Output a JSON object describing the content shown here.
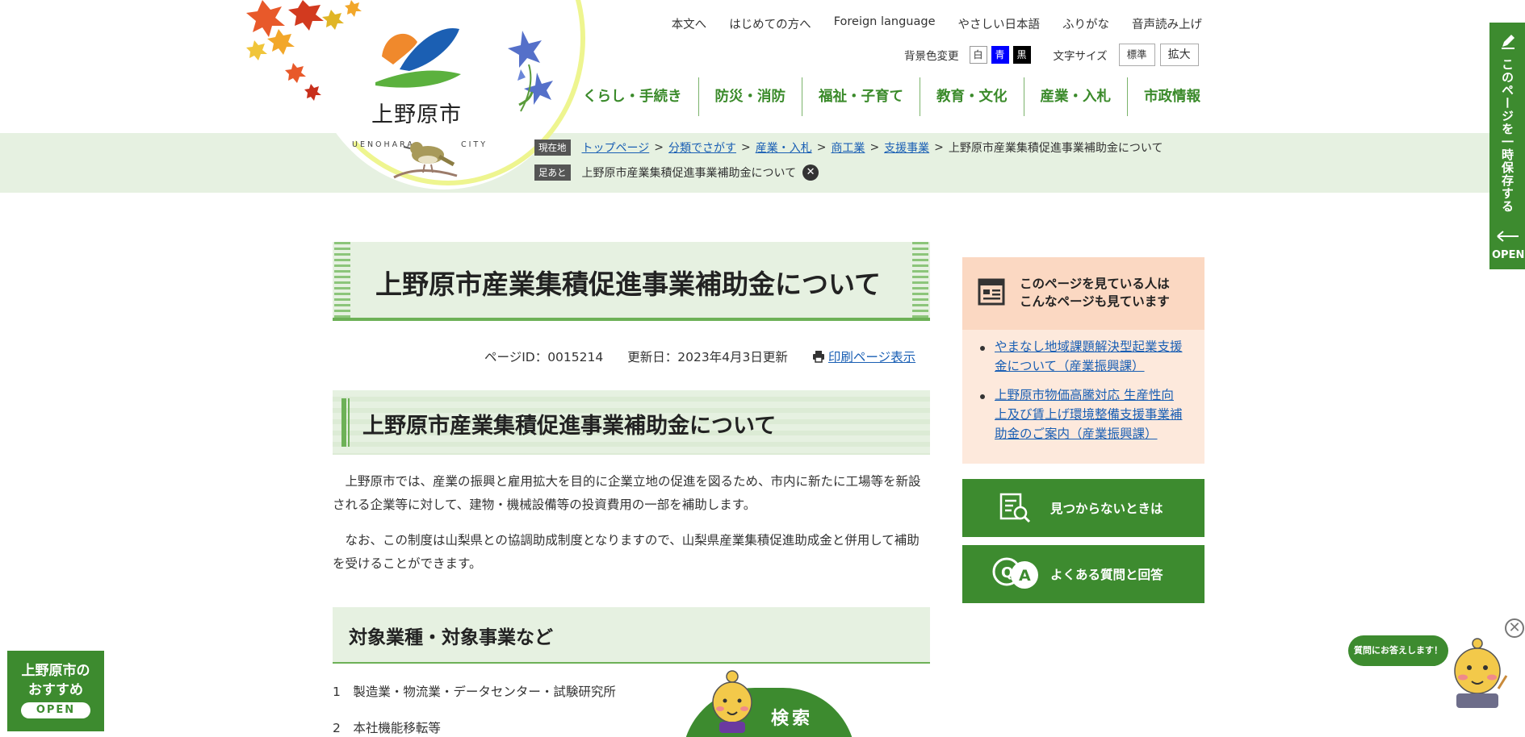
{
  "header": {
    "logo": {
      "name_jp": "上野原市",
      "name_en_left": "UENOHARA",
      "name_en_right": "CITY"
    },
    "util_links": [
      "本文へ",
      "はじめての方へ",
      "Foreign language",
      "やさしい日本語",
      "ふりがな",
      "音声読み上げ"
    ],
    "bg_color_label": "背景色変更",
    "bg_colors": [
      {
        "label": "白",
        "bg": "#ffffff",
        "fg": "#333333"
      },
      {
        "label": "青",
        "bg": "#0000ff",
        "fg": "#ffffff"
      },
      {
        "label": "黒",
        "bg": "#000000",
        "fg": "#ffffff"
      }
    ],
    "font_size_label": "文字サイズ",
    "font_size_standard": "標準",
    "font_size_large": "拡大",
    "global_nav": [
      "くらし・手続き",
      "防災・消防",
      "福祉・子育て",
      "教育・文化",
      "産業・入札",
      "市政情報"
    ]
  },
  "breadcrumb": {
    "tag": "現在地",
    "links": [
      "トップページ",
      "分類でさがす",
      "産業・入札",
      "商工業",
      "支援事業"
    ],
    "separator": ">",
    "current": "上野原市産業集積促進事業補助金について"
  },
  "footprint": {
    "tag": "足あと",
    "item": "上野原市産業集積促進事業補助金について",
    "close": "✕"
  },
  "main": {
    "title": "上野原市産業集積促進事業補助金について",
    "page_id": "ページID：0015214",
    "updated": "更新日：2023年4月3日更新",
    "print_label": "印刷ページ表示",
    "h2": "上野原市産業集積促進事業補助金について",
    "para1": "上野原市では、産業の振興と雇用拡大を目的に企業立地の促進を図るため、市内に新たに工場等を新設される企業等に対して、建物・機械設備等の投資費用の一部を補助します。",
    "para2": "なお、この制度は山梨県との協調助成制度となりますので、山梨県産業集積促進助成金と併用して補助を受けることができます。",
    "h3": "対象業種・対象事業など",
    "list": [
      "1　製造業・物流業・データセンター・試験研究所",
      "2　本社機能移転等"
    ]
  },
  "sidebar": {
    "rec_title_line1": "このページを見ている人は",
    "rec_title_line2": "こんなページも見ています",
    "rec_items": [
      {
        "line1": "やまなし地域課題解決型起業支援",
        "line2": "金について（産業振興課）"
      },
      {
        "line1": "上野原市物価高騰対応 生産性向",
        "line2": "上及び賃上げ環境整備支援事業補",
        "line3": "助金のご案内（産業振興課）"
      }
    ],
    "not_found_label": "見つからないときは",
    "faq_label": "よくある質問と回答"
  },
  "floating": {
    "save_tab_text": "このページを一時保存する",
    "save_tab_open": "OPEN",
    "recommend_line1": "上野原市の",
    "recommend_line2": "おすすめ",
    "recommend_open": "OPEN",
    "search_label": "検索",
    "chat_bubble": "質問にお答えします！",
    "chat_close": "✕"
  }
}
